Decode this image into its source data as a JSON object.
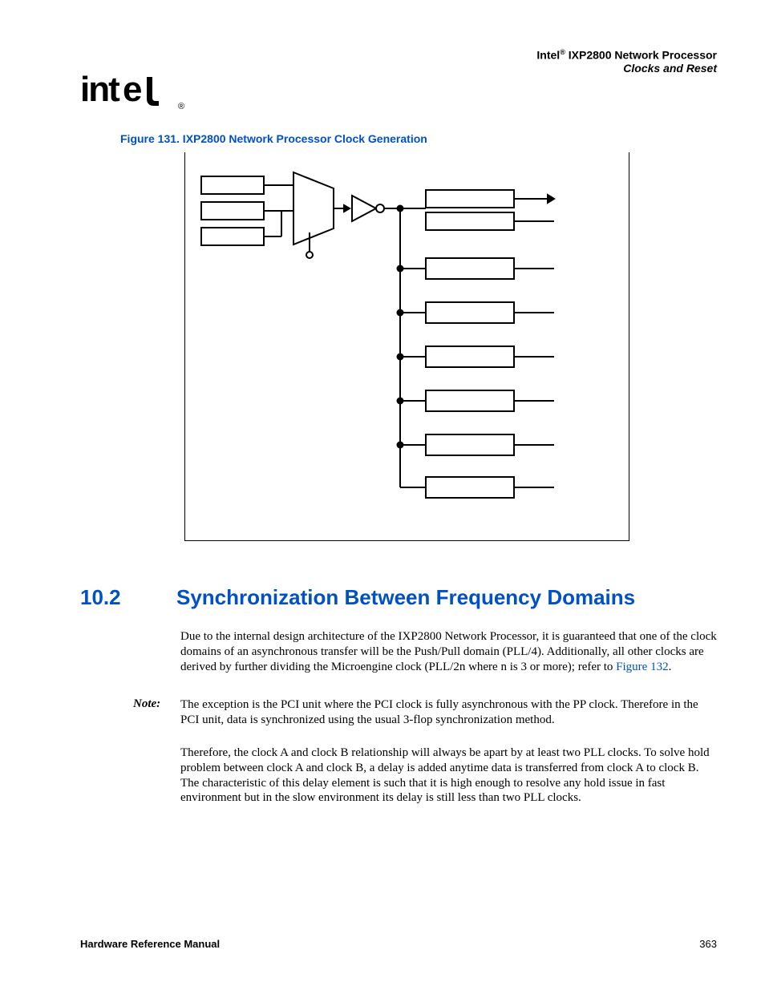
{
  "header": {
    "brand": "Intel",
    "reg": "®",
    "product": " IXP2800 Network Processor",
    "subtitle": "Clocks and Reset"
  },
  "logo": {
    "text": "intel",
    "reg": "®"
  },
  "figure": {
    "caption": "Figure 131. IXP2800 Network Processor Clock Generation"
  },
  "section": {
    "number": "10.2",
    "title": "Synchronization Between Frequency Domains"
  },
  "paragraphs": {
    "p1_a": "Due to the internal design architecture of the IXP2800 Network Processor, it is guaranteed that one of the clock domains of an asynchronous transfer will be the Push/Pull domain (PLL/4). Additionally, all other clocks are derived by further dividing the Microengine clock (PLL/2n where n is 3 or more); refer to ",
    "p1_link": "Figure 132",
    "p1_b": ".",
    "note_label": "Note:",
    "p2": "The exception is the PCI unit where the PCI clock is fully asynchronous with the PP clock. Therefore in the PCI unit, data is synchronized using the usual 3-flop synchronization method.",
    "p3": "Therefore, the clock A and clock B relationship will always be apart by at least two PLL clocks. To solve hold problem between clock A and clock B, a delay is added anytime data is transferred from clock A to clock B. The characteristic of this delay element is such that it is high enough to resolve any hold issue in fast environment but in the slow environment its delay is still less than two PLL clocks."
  },
  "footer": {
    "left": "Hardware Reference Manual",
    "right": "363"
  }
}
